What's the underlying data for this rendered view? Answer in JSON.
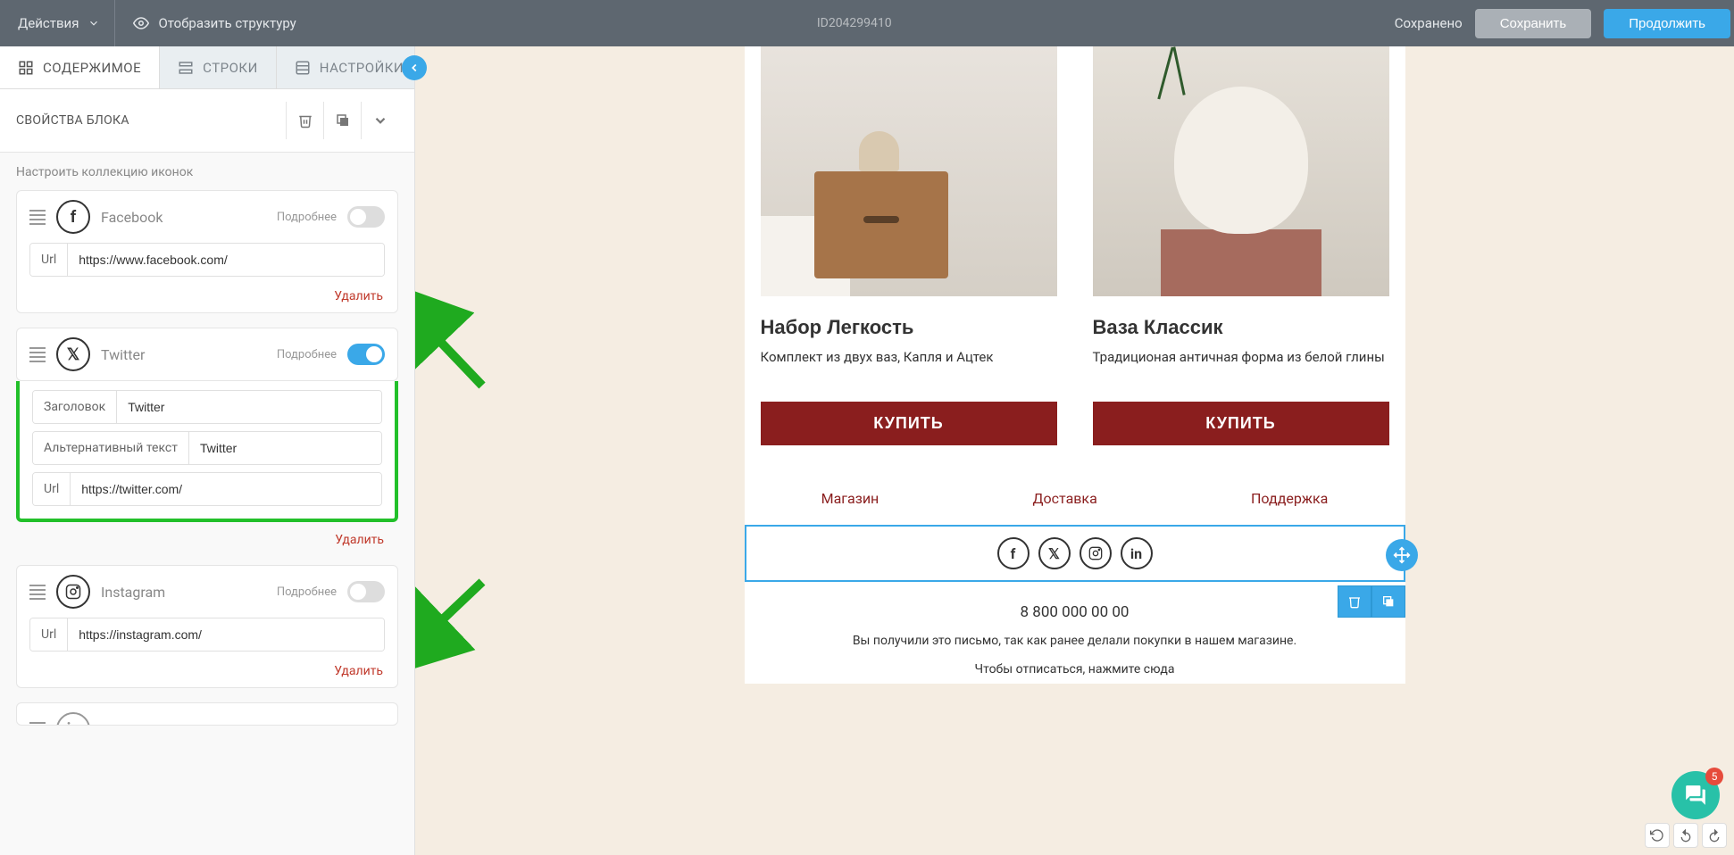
{
  "topbar": {
    "actions": "Действия",
    "show_structure": "Отобразить структуру",
    "doc_id": "ID204299410",
    "saved": "Сохранено",
    "save": "Сохранить",
    "continue": "Продолжить"
  },
  "tabs": {
    "content": "СОДЕРЖИМОЕ",
    "rows": "СТРОКИ",
    "settings": "НАСТРОЙКИ"
  },
  "panel": {
    "title": "СВОЙСТВА БЛОКА",
    "subtitle": "Настроить коллекцию иконок",
    "more": "Подробнее",
    "delete": "Удалить",
    "url_label": "Url",
    "title_label": "Заголовок",
    "alt_label": "Альтернативный текст"
  },
  "icons": {
    "facebook": {
      "name": "Facebook",
      "url": "https://www.facebook.com/"
    },
    "twitter": {
      "name": "Twitter",
      "title_value": "Twitter",
      "alt_value": "Twitter",
      "url": "https://twitter.com/"
    },
    "instagram": {
      "name": "Instagram",
      "url": "https://instagram.com/"
    }
  },
  "products": {
    "p1": {
      "title": "Набор Легкость",
      "desc": "Комплект из двух ваз, Капля и Ацтек",
      "buy": "КУПИТЬ"
    },
    "p2": {
      "title": "Ваза Классик",
      "desc": "Традиционая античная форма из белой глины",
      "buy": "КУПИТЬ"
    }
  },
  "footer": {
    "shop": "Магазин",
    "delivery": "Доставка",
    "support": "Поддержка",
    "phone": "8 800 000 00 00",
    "disclaimer1": "Вы получили это письмо, так как ранее делали покупки в нашем магазине.",
    "disclaimer2": "Чтобы отписаться, нажмите сюда"
  },
  "chat_badge": "5"
}
